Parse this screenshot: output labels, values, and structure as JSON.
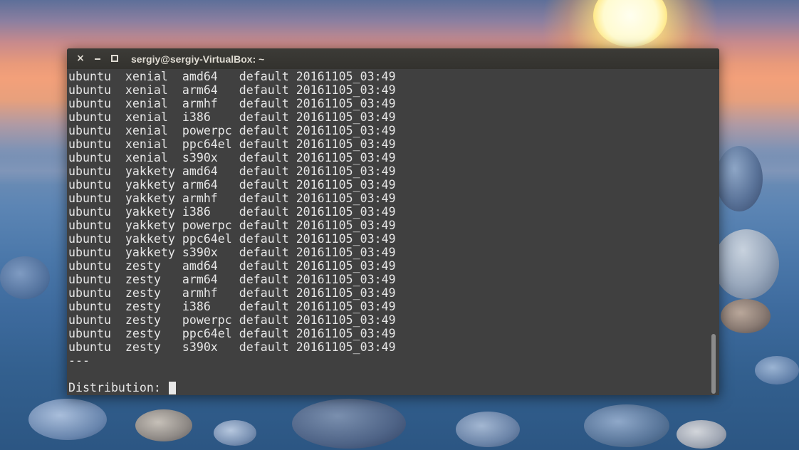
{
  "window": {
    "title": "sergiy@sergiy-VirtualBox: ~",
    "close_glyph": "×",
    "controls": [
      "close-icon",
      "minimize-icon",
      "maximize-icon"
    ]
  },
  "terminal": {
    "lines": [
      "ubuntu  xenial  amd64   default 20161105_03:49",
      "ubuntu  xenial  arm64   default 20161105_03:49",
      "ubuntu  xenial  armhf   default 20161105_03:49",
      "ubuntu  xenial  i386    default 20161105_03:49",
      "ubuntu  xenial  powerpc default 20161105_03:49",
      "ubuntu  xenial  ppc64el default 20161105_03:49",
      "ubuntu  xenial  s390x   default 20161105_03:49",
      "ubuntu  yakkety amd64   default 20161105_03:49",
      "ubuntu  yakkety arm64   default 20161105_03:49",
      "ubuntu  yakkety armhf   default 20161105_03:49",
      "ubuntu  yakkety i386    default 20161105_03:49",
      "ubuntu  yakkety powerpc default 20161105_03:49",
      "ubuntu  yakkety ppc64el default 20161105_03:49",
      "ubuntu  yakkety s390x   default 20161105_03:49",
      "ubuntu  zesty   amd64   default 20161105_03:49",
      "ubuntu  zesty   arm64   default 20161105_03:49",
      "ubuntu  zesty   armhf   default 20161105_03:49",
      "ubuntu  zesty   i386    default 20161105_03:49",
      "ubuntu  zesty   powerpc default 20161105_03:49",
      "ubuntu  zesty   ppc64el default 20161105_03:49",
      "ubuntu  zesty   s390x   default 20161105_03:49",
      "---",
      ""
    ],
    "prompt": "Distribution: "
  },
  "colors": {
    "terminal_bg": "#404040",
    "terminal_fg": "#e6e6e6",
    "titlebar_bg": "#3c3b37"
  }
}
